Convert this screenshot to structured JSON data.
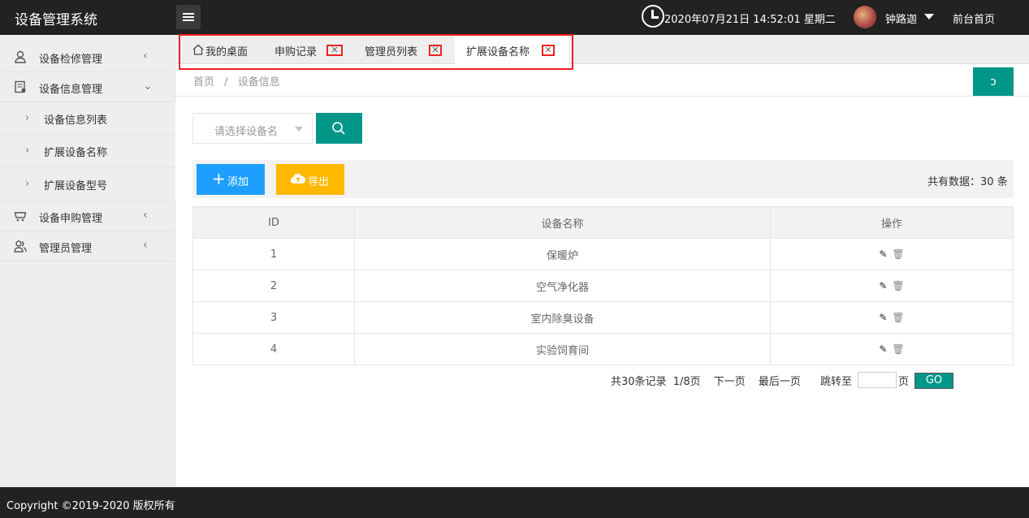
{
  "header": {
    "brand": "设备管理系统",
    "datetime": "2020年07月21日 14:52:01 星期二",
    "username": "钟路迦",
    "front_link": "前台首页"
  },
  "sidebar": {
    "items": [
      {
        "label": "设备检修管理",
        "icon": "user-icon",
        "arrow": "‹"
      },
      {
        "label": "设备信息管理",
        "icon": "document-icon",
        "arrow": "⌄"
      },
      {
        "label": "设备申购管理",
        "icon": "cart-icon",
        "arrow": "‹"
      },
      {
        "label": "管理员管理",
        "icon": "users-icon",
        "arrow": "‹"
      }
    ],
    "subitems": [
      {
        "label": "设备信息列表"
      },
      {
        "label": "扩展设备名称"
      },
      {
        "label": "扩展设备型号"
      }
    ]
  },
  "tabs": [
    {
      "label": "我的桌面"
    },
    {
      "label": "申购记录"
    },
    {
      "label": "管理员列表"
    },
    {
      "label": "扩展设备名称"
    }
  ],
  "breadcrumb": {
    "home": "首页",
    "sep": "/",
    "current": "设备信息"
  },
  "search": {
    "placeholder": "请选择设备名"
  },
  "toolbar": {
    "add_label": "添加",
    "export_label": "导出",
    "total_prefix": "共有数据：",
    "total_count": "30",
    "total_suffix": " 条"
  },
  "table": {
    "headers": [
      "ID",
      "设备名称",
      "操作"
    ],
    "rows": [
      {
        "id": "1",
        "name": "保暖炉"
      },
      {
        "id": "2",
        "name": "空气净化器"
      },
      {
        "id": "3",
        "name": "室内除臭设备"
      },
      {
        "id": "4",
        "name": "实验饲育间"
      }
    ]
  },
  "pagination": {
    "records": "共30条记录",
    "page": "1/8页",
    "next": "下一页",
    "last": "最后一页",
    "jump_label": "跳转至",
    "jump_unit": "页",
    "go": "GO"
  },
  "footer": {
    "copyright": "Copyright ©2019-2020 版权所有"
  },
  "colors": {
    "primary": "#009688",
    "blue": "#1e9fff",
    "yellow": "#ffb800",
    "dark": "#222222",
    "highlight": "#ee2222"
  }
}
